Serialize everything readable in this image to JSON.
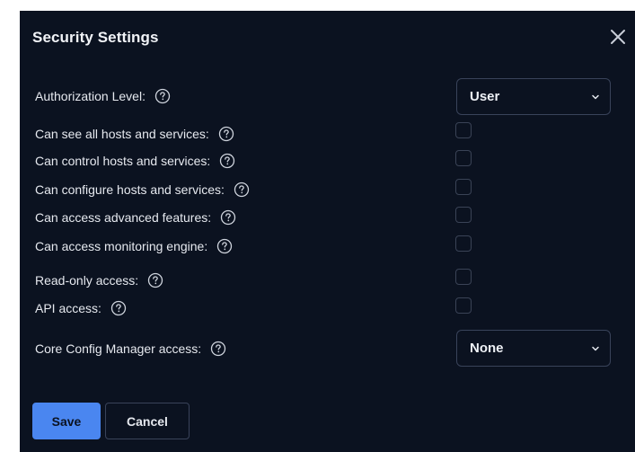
{
  "dialog": {
    "title": "Security Settings",
    "close_icon": "close-icon"
  },
  "authorization": {
    "label": "Authorization Level:",
    "selected": "User"
  },
  "permissions": [
    {
      "label": "Can see all hosts and services:",
      "checked": false
    },
    {
      "label": "Can control hosts and services:",
      "checked": false
    },
    {
      "label": "Can configure hosts and services:",
      "checked": false
    },
    {
      "label": "Can access advanced features:",
      "checked": false
    },
    {
      "label": "Can access monitoring engine:",
      "checked": false
    },
    {
      "label": "Read-only access:",
      "checked": false
    },
    {
      "label": "API access:",
      "checked": false
    }
  ],
  "ccm": {
    "label": "Core Config Manager access:",
    "selected": "None"
  },
  "actions": {
    "save_label": "Save",
    "cancel_label": "Cancel"
  },
  "colors": {
    "background": "#0b1220",
    "accent": "#4a86f0",
    "border": "#39435a",
    "text": "#e6e9ef"
  }
}
